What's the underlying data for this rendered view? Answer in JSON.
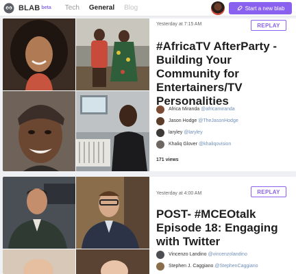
{
  "header": {
    "brand": "BLAB",
    "beta": "beta",
    "nav": [
      "Tech",
      "General",
      "Blog"
    ],
    "new_blab_label": "Start a new blab"
  },
  "cards": [
    {
      "time": "Yesterday at 7:15 AM",
      "replay_label": "REPLAY",
      "title": "#AfricaTV AfterParty - Building Your Community for Entertainers/TV Personalities",
      "speakers": [
        {
          "name": "Africa Miranda",
          "handle": "@africamiranda"
        },
        {
          "name": "Jason Hodge",
          "handle": "@TheJasonHodge"
        },
        {
          "name": "laryley",
          "handle": "@laryley"
        },
        {
          "name": "Khaliq Glover",
          "handle": "@khaliqovision"
        }
      ],
      "views": "171 views"
    },
    {
      "time": "Yesterday at 4:00 AM",
      "replay_label": "REPLAY",
      "title": "POST- #MCEOtalk Episode 18: Engaging with Twitter",
      "speakers": [
        {
          "name": "Vincenzo Landino",
          "handle": "@vincenzolandino"
        },
        {
          "name": "Stephen J. Caggiano",
          "handle": "@StephenCaggiano"
        }
      ]
    }
  ],
  "colors": {
    "accent": "#8a61ee",
    "handle": "#6f8fb8"
  }
}
